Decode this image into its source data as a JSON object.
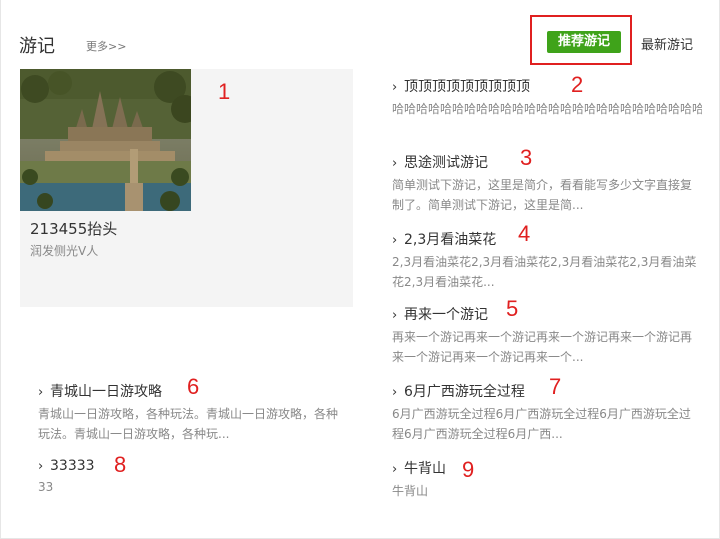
{
  "header": {
    "title": "游记",
    "more_label": "更多>>",
    "tabs": [
      {
        "label": "推荐游记",
        "active": true
      },
      {
        "label": "最新游记",
        "active": false
      }
    ]
  },
  "featured": {
    "title": "213455抬头",
    "author": "润发侧光V人",
    "image_icon": "temple-photo"
  },
  "items": [
    {
      "title": "顶顶顶顶顶顶顶顶顶",
      "desc": "哈哈哈哈哈哈哈哈哈哈哈哈哈哈哈哈哈哈哈哈哈哈哈哈哈哈"
    },
    {
      "title": "思途测试游记",
      "desc": "简单测试下游记，这里是简介，看看能写多少文字直接复制了。简单测试下游记，这里是简..."
    },
    {
      "title": "2,3月看油菜花",
      "desc": "2,3月看油菜花2,3月看油菜花2,3月看油菜花2,3月看油菜花2,3月看油菜花..."
    },
    {
      "title": "再来一个游记",
      "desc": "再来一个游记再来一个游记再来一个游记再来一个游记再来一个游记再来一个游记再来一个..."
    },
    {
      "title": "青城山一日游攻略",
      "desc": "青城山一日游攻略，各种玩法。青城山一日游攻略，各种玩法。青城山一日游攻略，各种玩..."
    },
    {
      "title": "6月广西游玩全过程",
      "desc": "6月广西游玩全过程6月广西游玩全过程6月广西游玩全过程6月广西游玩全过程6月广西..."
    },
    {
      "title": "33333",
      "desc": "33"
    },
    {
      "title": "牛背山",
      "desc": "牛背山"
    }
  ],
  "annotations": [
    "1",
    "2",
    "3",
    "4",
    "5",
    "6",
    "7",
    "8",
    "9"
  ],
  "colors": {
    "accent_green": "#3fa31a",
    "annotation_red": "#e02020",
    "muted_text": "#888888"
  }
}
